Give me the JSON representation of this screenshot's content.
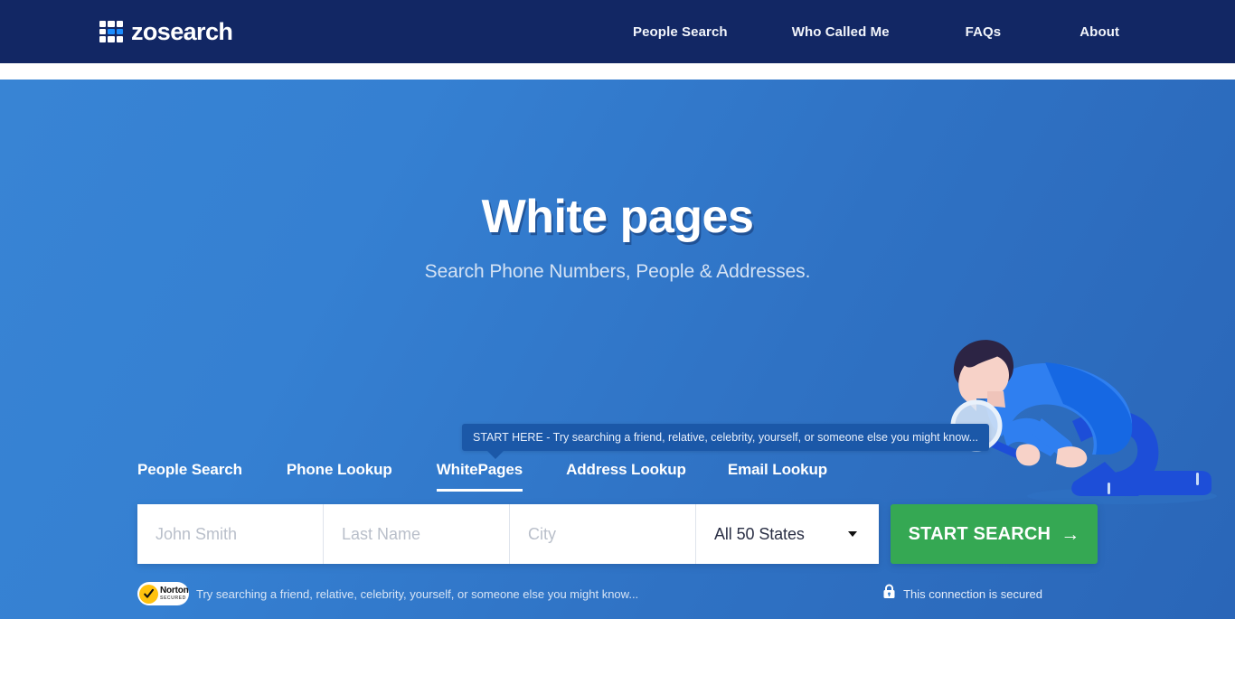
{
  "header": {
    "logo": {
      "icon": "grid-logo-icon",
      "text": "zosearch"
    },
    "nav": [
      {
        "label": "People Search"
      },
      {
        "label": "Who Called Me"
      },
      {
        "label": "FAQs"
      },
      {
        "label": "About"
      }
    ]
  },
  "hero": {
    "title": "White pages",
    "subtitle": "Search Phone Numbers, People & Addresses.",
    "tooltip": "START HERE - Try searching a friend, relative, celebrity, yourself, or someone else you might know...",
    "illustration_name": "man-with-magnifying-glass-illustration",
    "tabs": [
      {
        "label": "People Search",
        "active": false
      },
      {
        "label": "Phone Lookup",
        "active": false
      },
      {
        "label": "WhitePages",
        "active": true
      },
      {
        "label": "Address Lookup",
        "active": false
      },
      {
        "label": "Email Lookup",
        "active": false
      }
    ],
    "search": {
      "first_name": {
        "placeholder": "John Smith",
        "value": ""
      },
      "last_name": {
        "placeholder": "Last Name",
        "value": ""
      },
      "city": {
        "placeholder": "City",
        "value": ""
      },
      "state": {
        "selected": "All 50 States"
      },
      "submit_label": "START SEARCH",
      "submit_arrow": "→"
    },
    "footer": {
      "norton_badge": {
        "title": "Norton",
        "subtitle": "SECURED"
      },
      "norton_text": "Try searching a friend, relative, celebrity, yourself, or someone else you might know...",
      "secured_text": "This connection is secured",
      "lock_icon": "padlock-icon"
    }
  },
  "colors": {
    "header_navy": "#122764",
    "hero_blue": "#3580d2",
    "accent_blue": "#1a8cff",
    "cta_green": "#35a853",
    "norton_yellow": "#ffc20e",
    "tooltip_blue": "#1b58a8"
  }
}
